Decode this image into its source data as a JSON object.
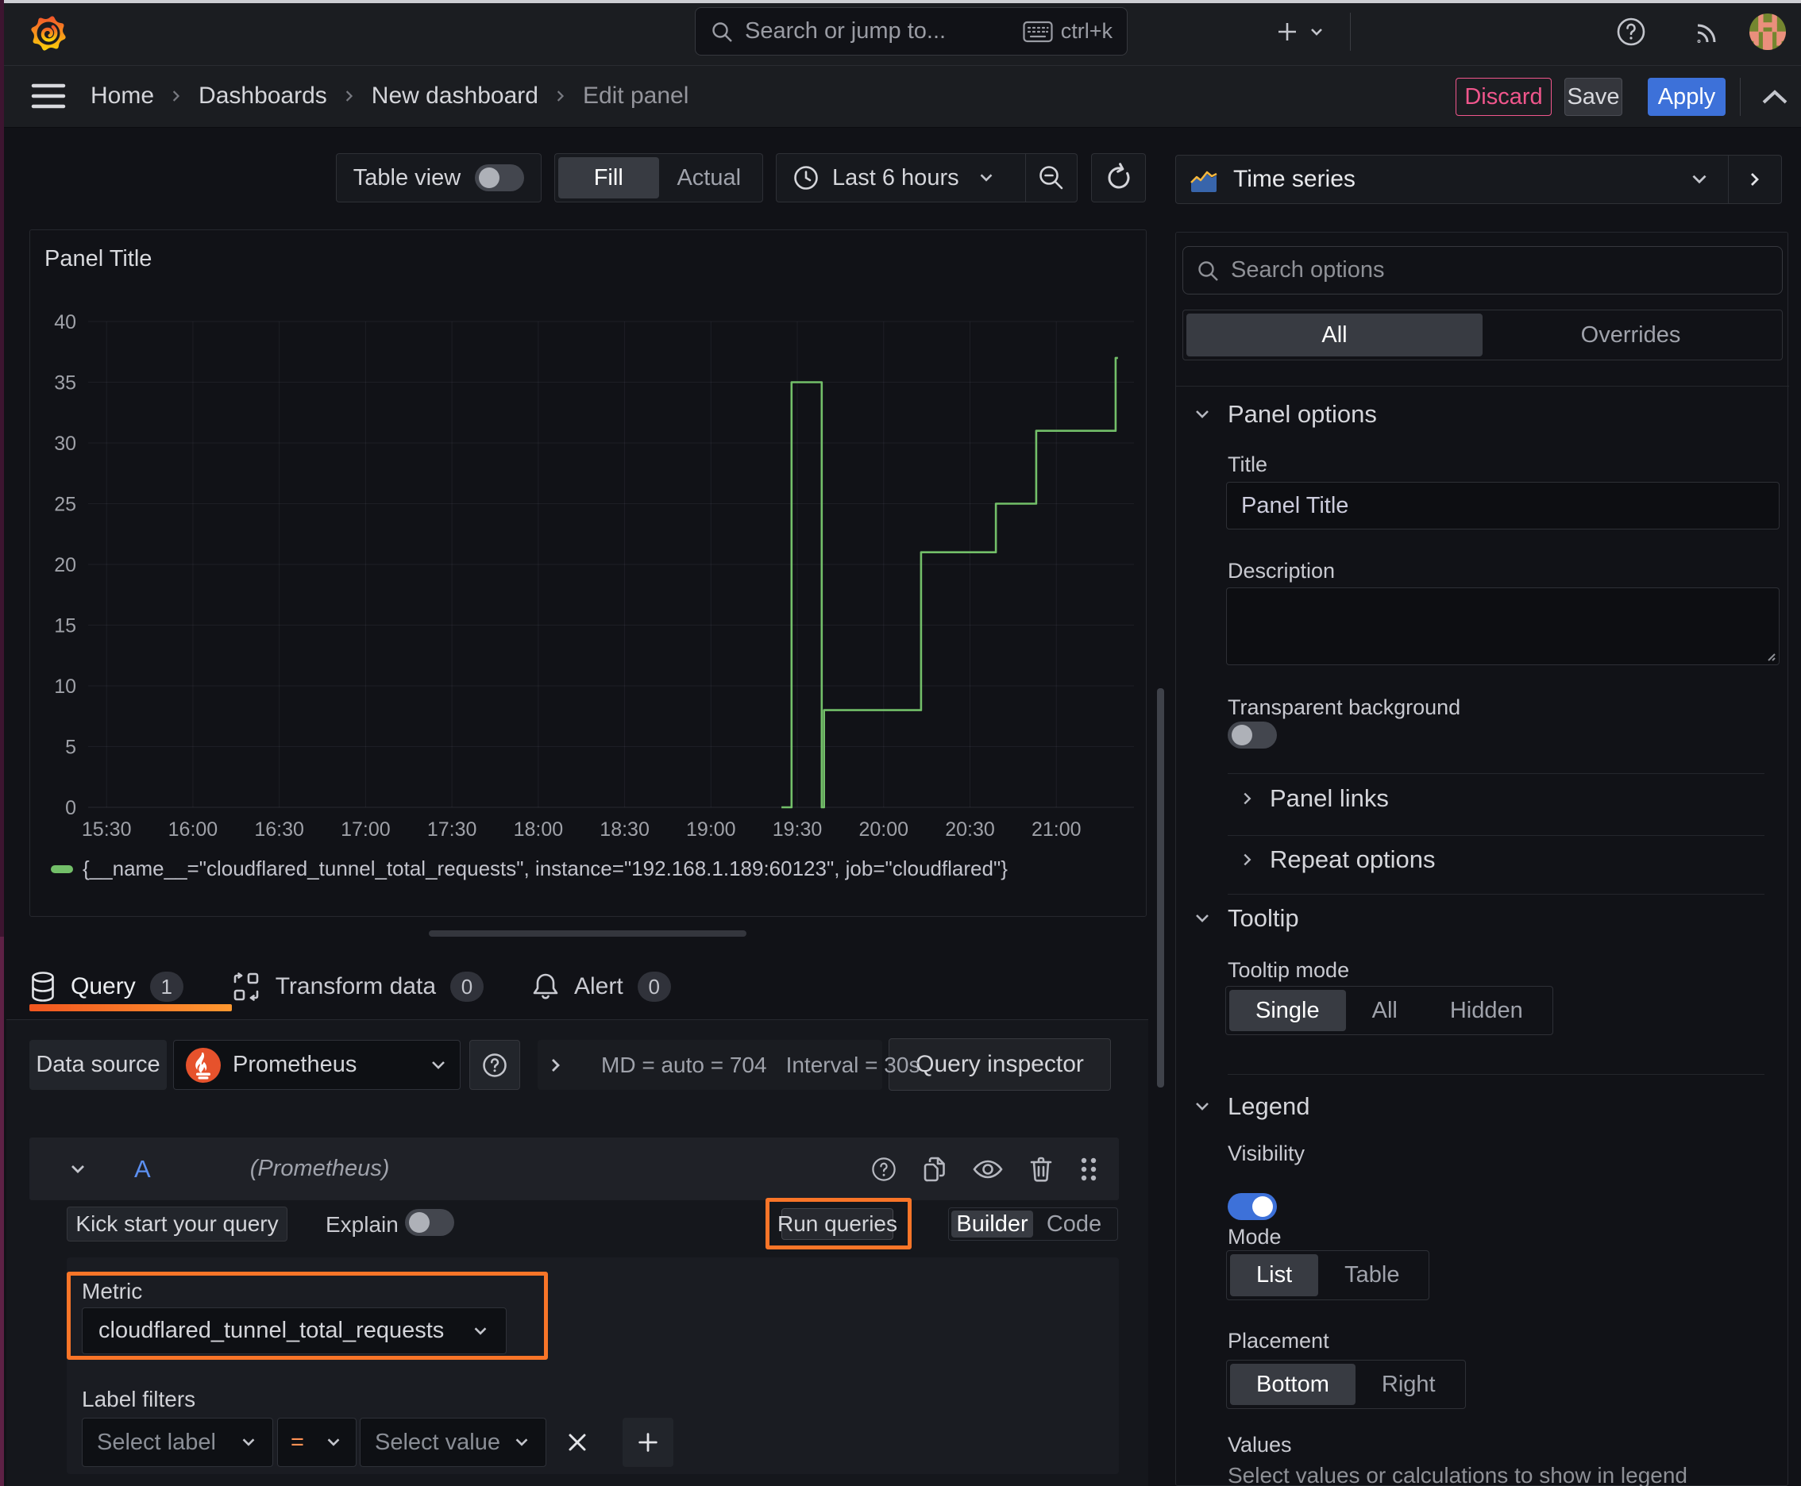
{
  "topbar": {
    "search_placeholder": "Search or jump to...",
    "shortcut": "ctrl+k"
  },
  "breadcrumb_bar": {
    "items": [
      {
        "label": "Home",
        "muted": false
      },
      {
        "label": "Dashboards",
        "muted": false
      },
      {
        "label": "New dashboard",
        "muted": false
      },
      {
        "label": "Edit panel",
        "muted": true
      }
    ],
    "discard_label": "Discard",
    "save_label": "Save",
    "apply_label": "Apply"
  },
  "toolbar": {
    "table_view_label": "Table view",
    "table_view_on": false,
    "fill_actual": {
      "options": [
        "Fill",
        "Actual"
      ],
      "selected": "Fill"
    },
    "time_range_label": "Last 6 hours"
  },
  "panel": {
    "title": "Panel Title"
  },
  "chart_data": {
    "type": "line",
    "title": "Panel Title",
    "xlabel": "",
    "ylabel": "",
    "x_tick_labels": [
      "15:30",
      "16:00",
      "16:30",
      "17:00",
      "17:30",
      "18:00",
      "18:30",
      "19:00",
      "19:30",
      "20:00",
      "20:30",
      "21:00"
    ],
    "x_tick_interval_minutes": 30,
    "y_ticks": [
      0,
      5,
      10,
      15,
      20,
      25,
      30,
      35,
      40
    ],
    "ylim": [
      0,
      40
    ],
    "grid": true,
    "legend_position": "bottom",
    "line_style": "step-after",
    "series": [
      {
        "name": "{__name__=\"cloudflared_tunnel_total_requests\", instance=\"192.168.1.189:60123\", job=\"cloudflared\"}",
        "color": "#73BF69",
        "points_minutes_vs_value": [
          [
            234.5,
            0
          ],
          [
            238,
            0
          ],
          [
            238,
            35
          ],
          [
            248.5,
            35
          ],
          [
            248.5,
            0
          ],
          [
            249.3,
            0
          ],
          [
            249.3,
            8
          ],
          [
            283,
            8
          ],
          [
            283,
            21
          ],
          [
            309,
            21
          ],
          [
            309,
            25
          ],
          [
            323,
            25
          ],
          [
            323,
            31
          ],
          [
            350.6,
            31
          ],
          [
            350.6,
            37
          ],
          [
            351.4,
            37
          ]
        ]
      }
    ]
  },
  "tabs": [
    {
      "label": "Query",
      "badge": "1",
      "active": true
    },
    {
      "label": "Transform data",
      "badge": "0",
      "active": false
    },
    {
      "label": "Alert",
      "badge": "0",
      "active": false
    }
  ],
  "query": {
    "datasource_label": "Data source",
    "datasource_value": "Prometheus",
    "max_data_points": "MD = auto = 704",
    "interval": "Interval = 30s",
    "inspector_label": "Query inspector",
    "row": {
      "ref": "A",
      "datasource_hint": "(Prometheus)"
    },
    "kickstart_label": "Kick start your query",
    "explain_label": "Explain",
    "explain_on": false,
    "run_queries_label": "Run queries",
    "builder_code": {
      "options": [
        "Builder",
        "Code"
      ],
      "selected": "Builder"
    },
    "metric_label": "Metric",
    "metric_value": "cloudflared_tunnel_total_requests",
    "label_filters_label": "Label filters",
    "select_label_placeholder": "Select label",
    "operator": "=",
    "select_value_placeholder": "Select value"
  },
  "sidebar": {
    "viz_type": "Time series",
    "search_placeholder": "Search options",
    "scope": {
      "options": [
        "All",
        "Overrides"
      ],
      "selected": "All"
    },
    "panel_options": {
      "title": "Panel options",
      "title_label": "Title",
      "title_value": "Panel Title",
      "description_label": "Description",
      "description_value": "",
      "transparent_label": "Transparent background",
      "transparent_on": false,
      "panel_links_label": "Panel links",
      "repeat_options_label": "Repeat options"
    },
    "tooltip": {
      "title": "Tooltip",
      "mode_label": "Tooltip mode",
      "mode": {
        "options": [
          "Single",
          "All",
          "Hidden"
        ],
        "selected": "Single"
      }
    },
    "legend": {
      "title": "Legend",
      "visibility_label": "Visibility",
      "visibility_on": true,
      "mode_label": "Mode",
      "mode": {
        "options": [
          "List",
          "Table"
        ],
        "selected": "List"
      },
      "placement_label": "Placement",
      "placement": {
        "options": [
          "Bottom",
          "Right"
        ],
        "selected": "Bottom"
      },
      "values_label": "Values",
      "values_hint": "Select values or calculations to show in legend"
    }
  },
  "colors": {
    "highlight_orange": "#f97528",
    "series_green": "#73BF69",
    "apply_blue": "#3d71d9",
    "discard_pink": "#f0568c",
    "tab_underline": [
      "#f2561f",
      "#ff9830"
    ]
  }
}
